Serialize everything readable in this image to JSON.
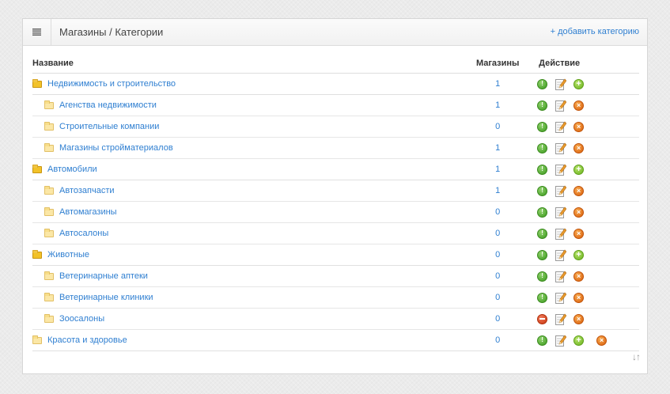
{
  "header": {
    "title": "Магазины / Категории",
    "add_link": "+ добавить категорию",
    "menu_icon": "hamburger-icon"
  },
  "table": {
    "columns": {
      "name": "Название",
      "stores": "Магазины",
      "actions": "Действие"
    },
    "rows": [
      {
        "name": "Недвижимость и строительство",
        "stores": "1",
        "level": 0,
        "status": "on",
        "actions": [
          "status",
          "edit",
          "add"
        ]
      },
      {
        "name": "Агенства недвижимости",
        "stores": "1",
        "level": 1,
        "status": "on",
        "actions": [
          "status",
          "edit",
          "delete"
        ]
      },
      {
        "name": "Строительные компании",
        "stores": "0",
        "level": 1,
        "status": "on",
        "actions": [
          "status",
          "edit",
          "delete"
        ]
      },
      {
        "name": "Магазины стройматериалов",
        "stores": "1",
        "level": 1,
        "status": "on",
        "actions": [
          "status",
          "edit",
          "delete"
        ]
      },
      {
        "name": "Автомобили",
        "stores": "1",
        "level": 0,
        "status": "on",
        "actions": [
          "status",
          "edit",
          "add"
        ]
      },
      {
        "name": "Автозапчасти",
        "stores": "1",
        "level": 1,
        "status": "on",
        "actions": [
          "status",
          "edit",
          "delete"
        ]
      },
      {
        "name": "Автомагазины",
        "stores": "0",
        "level": 1,
        "status": "on",
        "actions": [
          "status",
          "edit",
          "delete"
        ]
      },
      {
        "name": "Автосалоны",
        "stores": "0",
        "level": 1,
        "status": "on",
        "actions": [
          "status",
          "edit",
          "delete"
        ]
      },
      {
        "name": "Животные",
        "stores": "0",
        "level": 0,
        "status": "on",
        "actions": [
          "status",
          "edit",
          "add"
        ]
      },
      {
        "name": "Ветеринарные аптеки",
        "stores": "0",
        "level": 1,
        "status": "on",
        "actions": [
          "status",
          "edit",
          "delete"
        ]
      },
      {
        "name": "Ветеринарные клиники",
        "stores": "0",
        "level": 1,
        "status": "on",
        "actions": [
          "status",
          "edit",
          "delete"
        ]
      },
      {
        "name": "Зоосалоны",
        "stores": "0",
        "level": 1,
        "status": "off",
        "actions": [
          "status",
          "edit",
          "delete"
        ]
      },
      {
        "name": "Красота и здоровье",
        "stores": "0",
        "level": 0,
        "status": "on",
        "actions": [
          "status",
          "edit",
          "add",
          "delete"
        ]
      }
    ]
  },
  "footer": {
    "sort_icon": "↓↑"
  },
  "colors": {
    "link": "#2f7fd1",
    "enabled": "#3c9a1f",
    "disabled": "#c8360f",
    "add": "#6bb21f",
    "delete": "#d9600c"
  }
}
